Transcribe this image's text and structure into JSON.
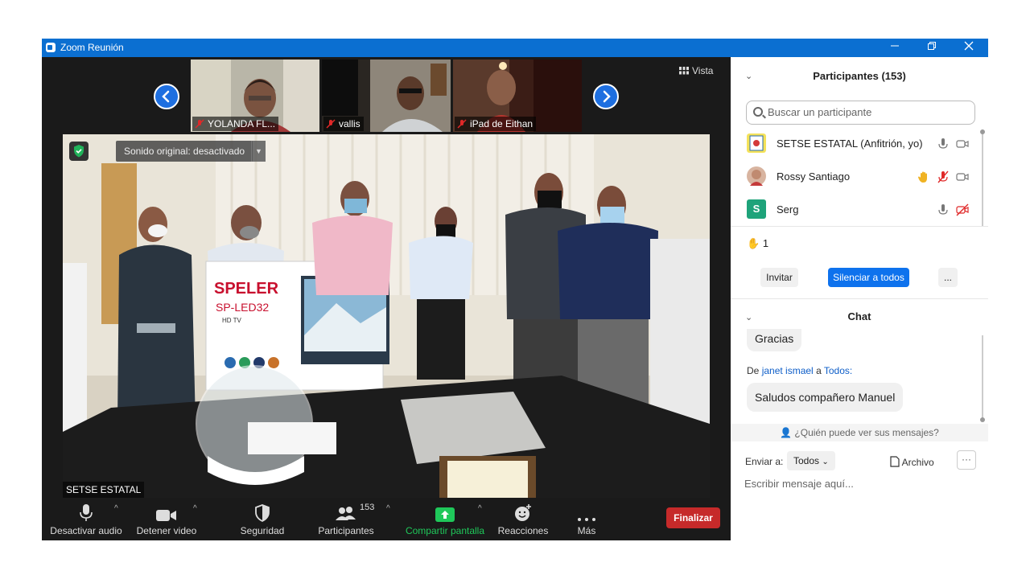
{
  "window": {
    "title": "Zoom Reunión"
  },
  "thumbnails": [
    {
      "name": "YOLANDA FL..."
    },
    {
      "name": "vallis"
    },
    {
      "name": "iPad de Eithan"
    }
  ],
  "view_button": {
    "label": "Vista"
  },
  "main_video": {
    "audio_status": "Sonido original: desactivado",
    "speaker": "SETSE ESTATAL",
    "scene_text": {
      "brand": "SPELER",
      "model": "SP-LED32",
      "sub": "HD TV"
    }
  },
  "toolbar": {
    "mute": "Desactivar audio",
    "video": "Detener video",
    "security": "Seguridad",
    "participants": "Participantes",
    "participants_count": "153",
    "share": "Compartir pantalla",
    "reactions": "Reacciones",
    "more": "Más",
    "end": "Finalizar"
  },
  "participants_panel": {
    "title": "Participantes (153)",
    "search_placeholder": "Buscar un participante",
    "list": [
      {
        "name": "SETSE ESTATAL (Anfitrión, yo)"
      },
      {
        "name": "Rossy Santiago"
      },
      {
        "name": "Serg",
        "initial": "S"
      }
    ],
    "raised_hands": "1",
    "invite": "Invitar",
    "mute_all": "Silenciar a todos",
    "more": "..."
  },
  "chat": {
    "title": "Chat",
    "messages": [
      {
        "text": "Gracias"
      },
      {
        "prefix": "De",
        "sender": "janet ismael",
        "connector": "a",
        "recipient": "Todos:",
        "text": "Saludos compañero Manuel"
      }
    ],
    "who_can_see": "¿Quién puede ver sus mensajes?",
    "send_to_label": "Enviar a:",
    "send_to_value": "Todos",
    "file": "Archivo",
    "more": "···",
    "compose_placeholder": "Escribir mensaje aquí..."
  },
  "colors": {
    "titlebar": "#0b6fd1",
    "end_button": "#c62a2a",
    "share_green": "#1fc85a",
    "link_blue": "#0e5ec8",
    "mute_all_blue": "#0e72ed"
  }
}
